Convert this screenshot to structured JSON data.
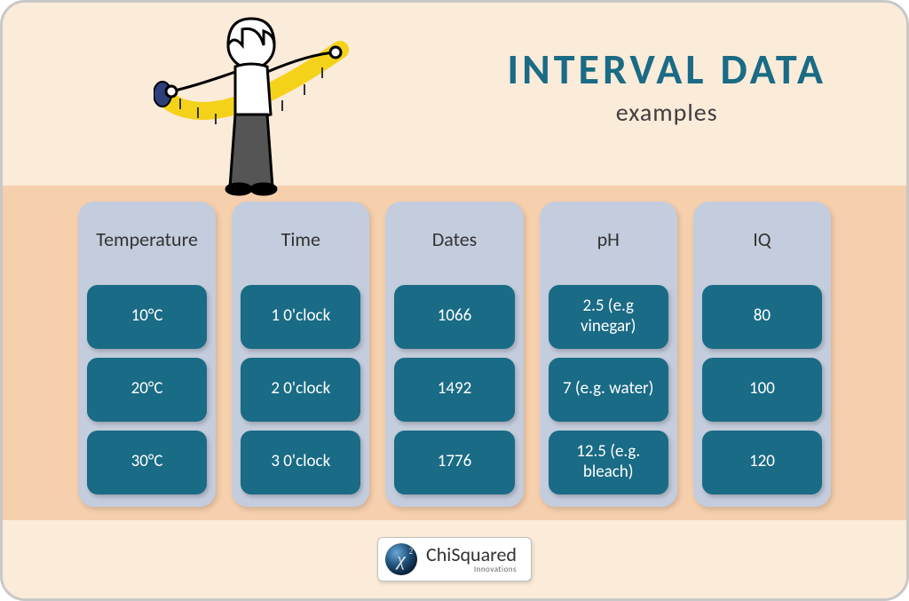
{
  "header": {
    "title": "INTERVAL DATA",
    "subtitle": "examples"
  },
  "columns": [
    {
      "title": "Temperature",
      "values": [
        "10°C",
        "20°C",
        "30°C"
      ]
    },
    {
      "title": "Time",
      "values": [
        "1 0'clock",
        "2 0'clock",
        "3 0'clock"
      ]
    },
    {
      "title": "Dates",
      "values": [
        "1066",
        "1492",
        "1776"
      ]
    },
    {
      "title": "pH",
      "values": [
        "2.5 (e.g vinegar)",
        "7 (e.g. water)",
        "12.5 (e.g. bleach)"
      ]
    },
    {
      "title": "IQ",
      "values": [
        "80",
        "100",
        "120"
      ]
    }
  ],
  "footer": {
    "brand_main": "ChiSquared",
    "brand_sub": "Innovations"
  },
  "colors": {
    "accent": "#1a6b85",
    "card_bg": "#c4cddd",
    "band": "#f6cfad",
    "page": "#fbebd9"
  }
}
